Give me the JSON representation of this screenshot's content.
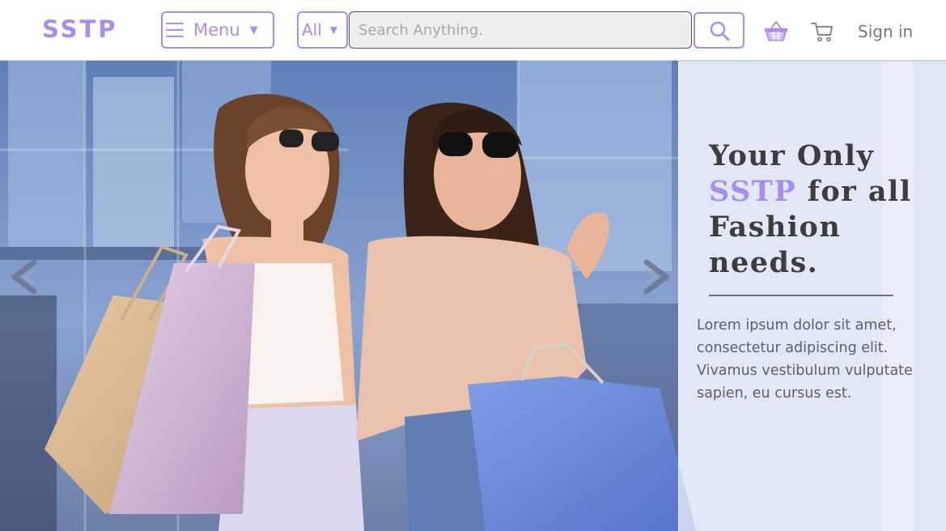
{
  "header": {
    "logo": "SSTP",
    "menu_label": "Menu",
    "category_value": "All",
    "search_placeholder": "Search Anything.",
    "sign_in": "Sign in"
  },
  "hero": {
    "heading_line1": "Your Only",
    "heading_brand": "SSTP",
    "heading_line2_rest": "for all",
    "heading_line3": "Fashion",
    "heading_line4": "needs.",
    "body": "Lorem ipsum dolor sit amet, consectetur adipiscing elit. Vivamus vestibulum vulputate sapien, eu cursus est."
  },
  "colors": {
    "accent": "#a98cf0",
    "text_dark": "#3d3d3d",
    "text_muted": "#777777"
  },
  "icons": [
    "hamburger-icon",
    "chevron-down-icon",
    "search-icon",
    "basket-icon",
    "cart-icon",
    "chevron-left-icon",
    "chevron-right-icon"
  ]
}
